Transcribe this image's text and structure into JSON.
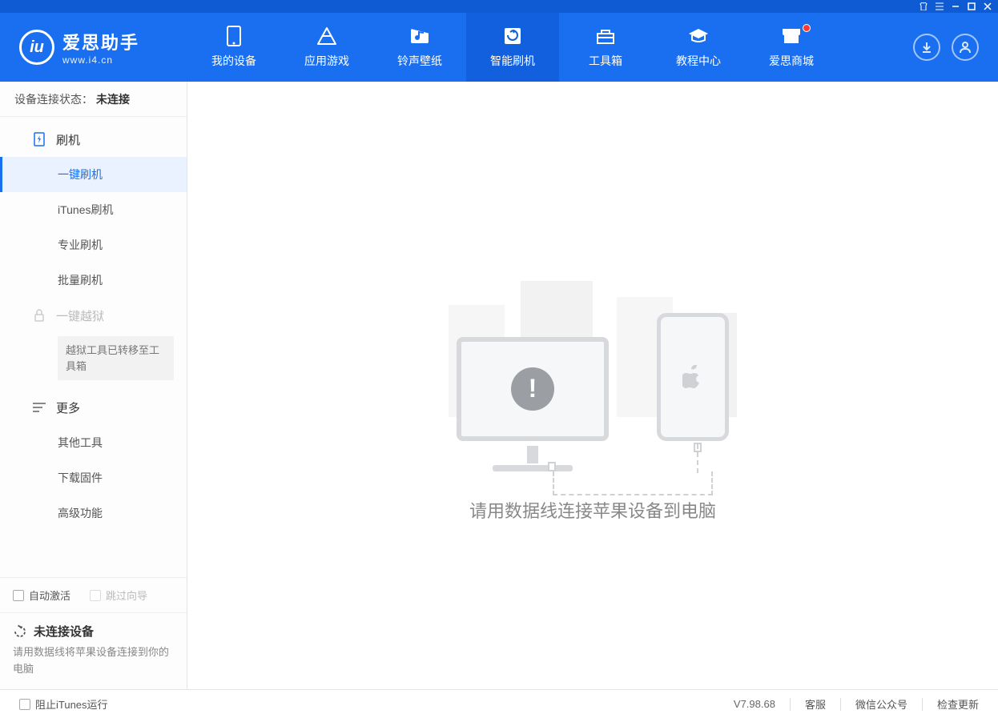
{
  "app": {
    "name": "爱思助手",
    "url": "www.i4.cn"
  },
  "nav": {
    "items": [
      {
        "label": "我的设备"
      },
      {
        "label": "应用游戏"
      },
      {
        "label": "铃声壁纸"
      },
      {
        "label": "智能刷机"
      },
      {
        "label": "工具箱"
      },
      {
        "label": "教程中心"
      },
      {
        "label": "爱思商城"
      }
    ]
  },
  "sidebar": {
    "conn_label": "设备连接状态：",
    "conn_value": "未连接",
    "section_flash": "刷机",
    "items_flash": {
      "one_key": "一键刷机",
      "itunes": "iTunes刷机",
      "pro": "专业刷机",
      "batch": "批量刷机"
    },
    "section_jailbreak": "一键越狱",
    "jailbreak_note": "越狱工具已转移至工具箱",
    "section_more": "更多",
    "items_more": {
      "other_tools": "其他工具",
      "download_fw": "下载固件",
      "advanced": "高级功能"
    },
    "opt_auto_activate": "自动激活",
    "opt_skip_guide": "跳过向导",
    "device_title": "未连接设备",
    "device_msg": "请用数据线将苹果设备连接到你的电脑"
  },
  "main": {
    "message": "请用数据线连接苹果设备到电脑",
    "alert_char": "!"
  },
  "footer": {
    "block_itunes": "阻止iTunes运行",
    "version": "V7.98.68",
    "support": "客服",
    "wechat": "微信公众号",
    "check_update": "检查更新"
  }
}
